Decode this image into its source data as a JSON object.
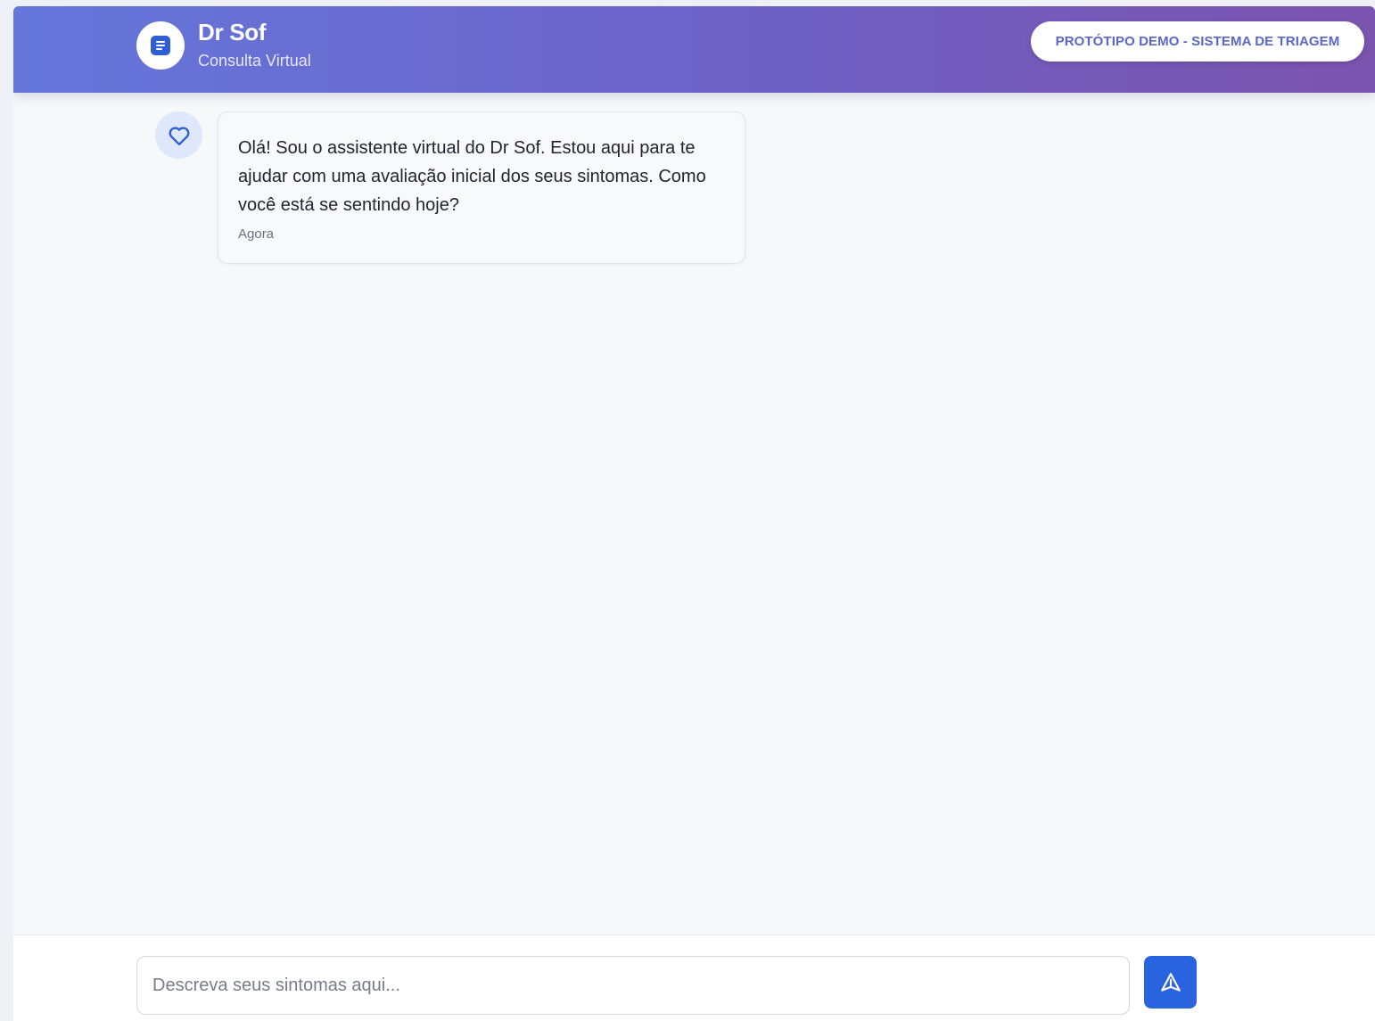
{
  "header": {
    "title": "Dr Sof",
    "subtitle": "Consulta Virtual",
    "badge": "PROTÓTIPO DEMO - SISTEMA DE TRIAGEM",
    "logo_icon": "document-icon"
  },
  "messages": [
    {
      "sender": "bot",
      "avatar_icon": "heart-icon",
      "text": "Olá! Sou o assistente virtual do Dr Sof. Estou aqui para te ajudar com uma avaliação inicial dos seus sintomas. Como você está se sentindo hoje?",
      "time": "Agora"
    }
  ],
  "composer": {
    "placeholder": "Descreva seus sintomas aqui...",
    "value": "",
    "send_icon": "send-icon"
  },
  "colors": {
    "header_gradient_start": "#6577db",
    "header_gradient_end": "#7a54ae",
    "accent": "#2a63e0",
    "badge_text": "#5a67c8"
  }
}
